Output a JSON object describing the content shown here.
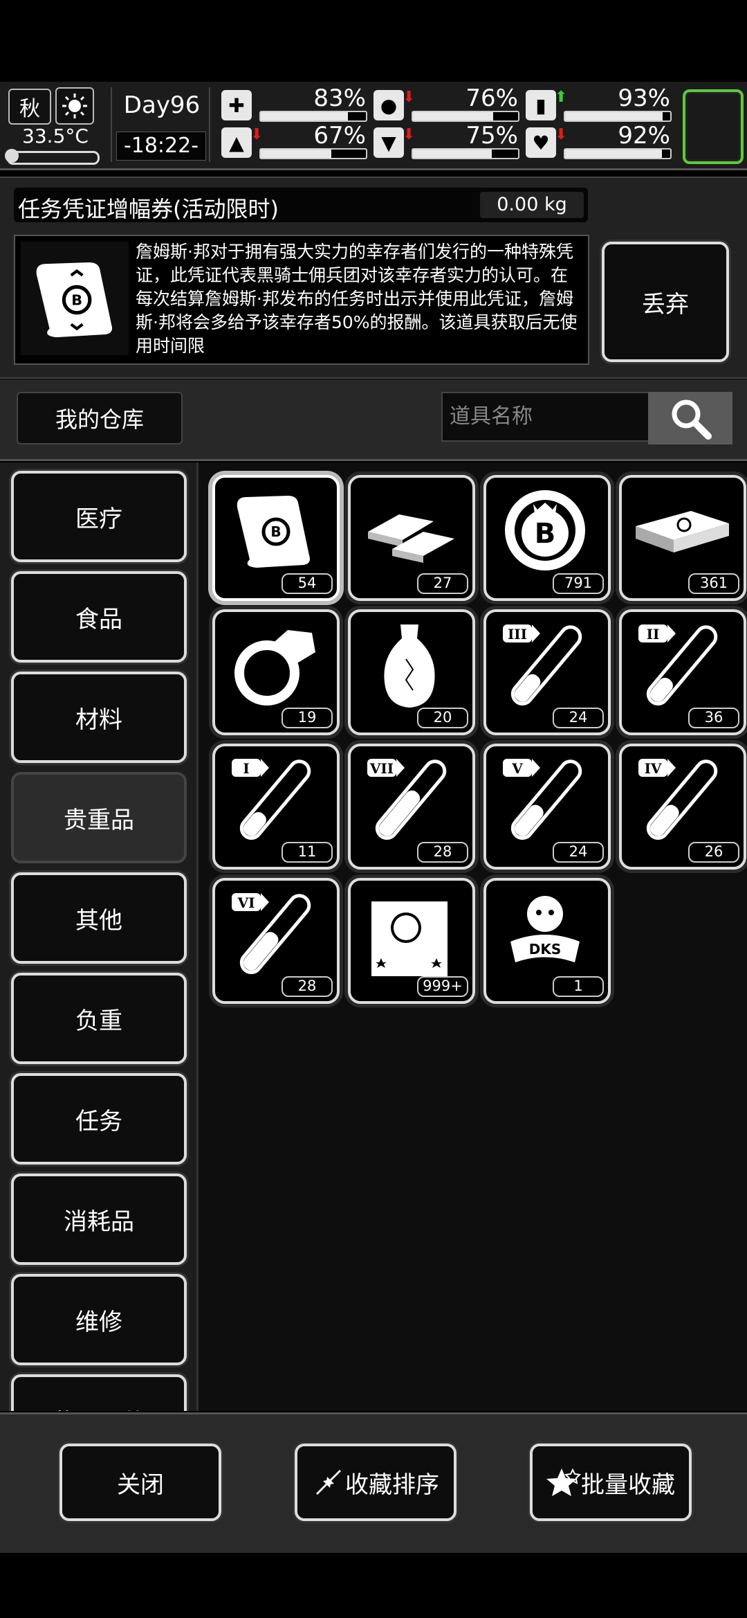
{
  "status": {
    "season": "秋",
    "temperature": "33.5°C",
    "day": "Day96",
    "time": "-18:22-",
    "stats": [
      {
        "name": "health",
        "value": "83%",
        "level": 0.83,
        "trend": "none"
      },
      {
        "name": "hunger",
        "value": "76%",
        "level": 0.76,
        "trend": "down"
      },
      {
        "name": "energy",
        "value": "93%",
        "level": 0.93,
        "trend": "up"
      },
      {
        "name": "stamina",
        "value": "67%",
        "level": 0.67,
        "trend": "down"
      },
      {
        "name": "thirst",
        "value": "75%",
        "level": 0.75,
        "trend": "down"
      },
      {
        "name": "mood",
        "value": "92%",
        "level": 0.92,
        "trend": "down"
      }
    ],
    "accent_color": "#5dcb3a"
  },
  "detail": {
    "title": "任务凭证增幅券(活动限时)",
    "weight": "0.00 kg",
    "description": "詹姆斯·邦对于拥有强大实力的幸存者们发行的一种特殊凭证，此凭证代表黑骑士佣兵团对该幸存者实力的认可。在每次结算詹姆斯·邦发布的任务时出示并使用此凭证，詹姆斯·邦将会多给予该幸存者50%的报酬。该道具获取后无使用时间限",
    "discard_label": "丢弃"
  },
  "warehouse": {
    "title": "我的仓库",
    "search_placeholder": "道具名称"
  },
  "categories": [
    {
      "label": "医疗"
    },
    {
      "label": "食品"
    },
    {
      "label": "材料"
    },
    {
      "label": "贵重品",
      "active": true
    },
    {
      "label": "其他"
    },
    {
      "label": "负重"
    },
    {
      "label": "任务"
    },
    {
      "label": "消耗品"
    },
    {
      "label": "维修"
    },
    {
      "label": "载具配件"
    }
  ],
  "items": [
    {
      "icon": "voucher-scroll-icon",
      "count": "54",
      "selected": true
    },
    {
      "icon": "gold-bars-icon",
      "count": "27"
    },
    {
      "icon": "b-coin-icon",
      "count": "791"
    },
    {
      "icon": "cash-stack-icon",
      "count": "361"
    },
    {
      "icon": "diamond-ring-icon",
      "count": "19"
    },
    {
      "icon": "vase-icon",
      "count": "20"
    },
    {
      "icon": "test-tube-iii-icon",
      "numeral": "III",
      "level": 0.35,
      "count": "24"
    },
    {
      "icon": "test-tube-ii-icon",
      "numeral": "II",
      "level": 0.3,
      "count": "36"
    },
    {
      "icon": "test-tube-i-icon",
      "numeral": "I",
      "level": 0.3,
      "count": "11"
    },
    {
      "icon": "test-tube-vii-icon",
      "numeral": "VII",
      "level": 0.6,
      "count": "28"
    },
    {
      "icon": "test-tube-v-icon",
      "numeral": "V",
      "level": 0.4,
      "count": "24"
    },
    {
      "icon": "test-tube-iv-icon",
      "numeral": "IV",
      "level": 0.4,
      "count": "26"
    },
    {
      "icon": "test-tube-vi-icon",
      "numeral": "VI",
      "level": 0.5,
      "count": "28"
    },
    {
      "icon": "zombie-poster-icon",
      "count": "999+"
    },
    {
      "icon": "dks-emblem-icon",
      "count": "1"
    }
  ],
  "bottom": {
    "close_label": "关闭",
    "sort_label": "收藏排序",
    "batch_label": "批量收藏"
  }
}
